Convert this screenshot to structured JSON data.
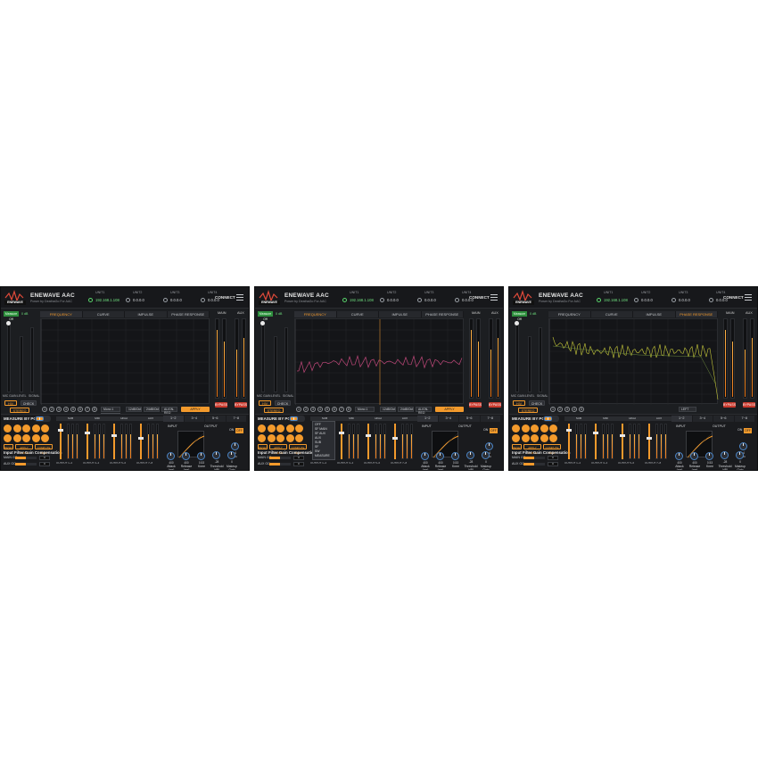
{
  "app": {
    "title": "ENEWAVE AAC",
    "subtitle": "Power by DeathaGo For AAC",
    "logo_text": "ENEWAVE",
    "connect_label": "CONNECT"
  },
  "units": [
    {
      "label": "UNIT1",
      "value": "192.168.1.108",
      "connected": true
    },
    {
      "label": "UNIT2",
      "value": "0.0.0.0",
      "connected": false
    },
    {
      "label": "UNIT3",
      "value": "0.0.0.0",
      "connected": false
    },
    {
      "label": "UNIT4",
      "value": "0.0.0.0",
      "connected": false
    }
  ],
  "tabs": [
    "FREQUENCY",
    "CURVE",
    "IMPULSE",
    "PHASE RESPONSE"
  ],
  "meter_labels": {
    "main": "MAIN",
    "aux": "AUX",
    "mic_gain": "MIC GAIN",
    "level": "LEVEL",
    "signal": "SIGNAL"
  },
  "measure_badge": "Measure Off",
  "measure_value": "0 dB",
  "buttons": {
    "hiv": "HIV",
    "check": "CHECK",
    "stereo": "STEREO",
    "apply_crossover": "APPLY CROSSOVER",
    "reset": "RESET",
    "apply_curve": "APPLY CURVE",
    "compute_new": "COMPUTE NEW",
    "bypass_main": "BYPASS",
    "bypass_aux": "BYPASS"
  },
  "point_numbers": [
    "1",
    "2",
    "3",
    "4",
    "5",
    "6",
    "7",
    "8"
  ],
  "combo": {
    "mono": "Mono 1",
    "slope": "12dB/Oct",
    "type": "24dB/Oct",
    "align": "ALIGN-REQ",
    "left": "LEFT"
  },
  "dropdown_mono": [
    "Mono 1",
    "Stereo 1"
  ],
  "dropdown_channels": [
    "OFF",
    "SF MAIN",
    "SF AUX",
    "AUX",
    "SUB",
    "SF",
    "SW",
    "MEASURE"
  ],
  "measure_by_point": "MEASURE BY POINT",
  "input_filter": "Input Filter Gain Compensation",
  "gc_rows": [
    {
      "label": "MAIN GC",
      "value": "0"
    },
    {
      "label": "AUX GC",
      "value": "0"
    }
  ],
  "strips": [
    {
      "head": "SUB",
      "output": "OUTPUT 1~2"
    },
    {
      "head": "MID",
      "output": "OUTPUT 3~4"
    },
    {
      "head": "HIGH",
      "output": "OUTPUT 5~6"
    },
    {
      "head": "AUX",
      "output": "OUTPUT 7~8"
    }
  ],
  "range_tabs": [
    "1~2",
    "3~4",
    "5~6",
    "7~8"
  ],
  "compressor": {
    "input_label": "INPUT",
    "output_label": "OUTPUT",
    "on_label": "ON",
    "off_label": "OFF",
    "knobs": [
      {
        "label": "Attack (ms)",
        "value": "400"
      },
      {
        "label": "Release (ms)",
        "value": "400"
      },
      {
        "label": "Knee",
        "value": "0.53"
      },
      {
        "label": "Threshold (dB)",
        "value": "-28"
      },
      {
        "label": "Makeup Gain",
        "value": "0"
      }
    ],
    "ratio_label": "Ratio",
    "ratio_value": "4"
  },
  "colors": {
    "accent": "#f39a2c",
    "panel": "#1c1e21",
    "green": "#59d36b",
    "curve_pink": "#c0487a",
    "curve_yellow": "#c7c93a"
  }
}
